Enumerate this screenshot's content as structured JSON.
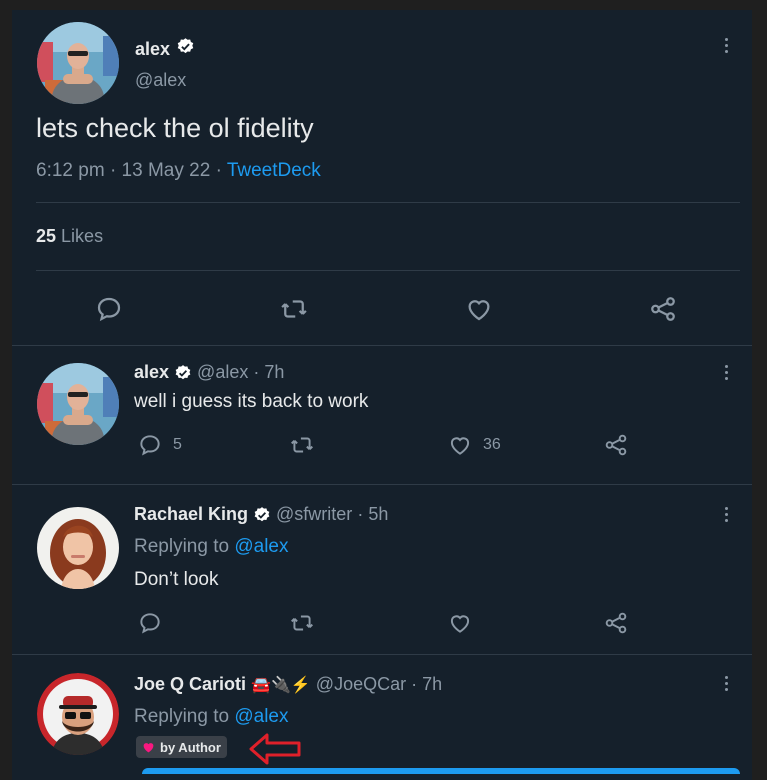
{
  "main_tweet": {
    "name": "alex",
    "handle": "@alex",
    "text": "lets check the ol fidelity",
    "time": "6:12 pm",
    "date": "13 May 22",
    "source": "TweetDeck",
    "likes_count": "25",
    "likes_label": "Likes",
    "sep": "·"
  },
  "replies": [
    {
      "name": "alex",
      "handle": "@alex",
      "age": "7h",
      "text": "well i guess its back to work",
      "reply_count": "5",
      "like_count": "36"
    },
    {
      "name": "Rachael King",
      "handle": "@sfwriter",
      "age": "5h",
      "replying_label": "Replying to",
      "replying_to": "@alex",
      "text": "Don’t look"
    },
    {
      "name": "Joe Q Carioti",
      "emojis": "🚘🔌⚡",
      "handle": "@JoeQCar",
      "age": "7h",
      "replying_label": "Replying to",
      "replying_to": "@alex",
      "badge": "by Author"
    }
  ],
  "colors": {
    "background": "#15202b",
    "accent": "#1d9bf0",
    "muted": "#8b98a5",
    "annotation_arrow": "#e0202a",
    "badge_heart": "#f91880"
  }
}
